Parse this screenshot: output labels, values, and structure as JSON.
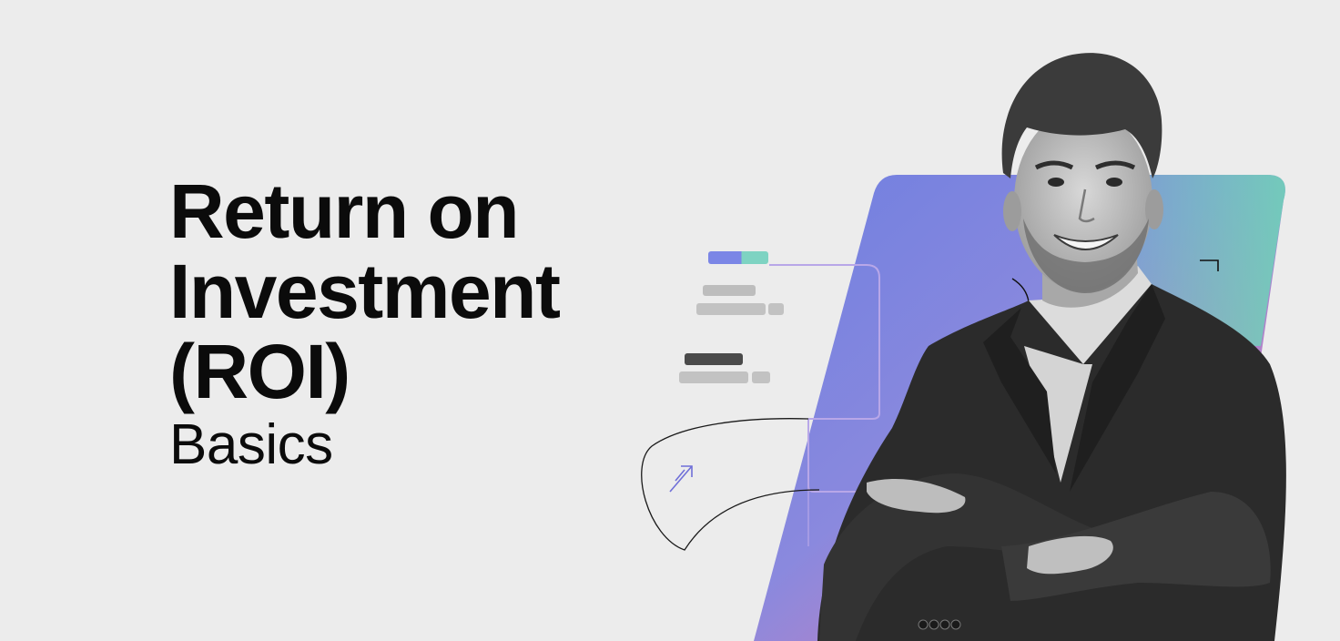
{
  "hero": {
    "title_lines": [
      "Return on",
      "Investment",
      "(ROI)"
    ],
    "subtitle": "Basics"
  },
  "colors": {
    "background": "#ececec",
    "text": "#0b0b0b",
    "gradient_blue": "#6f7fe0",
    "gradient_teal": "#6fd1b8",
    "gradient_pink": "#f07aa8",
    "bar_accent_blue": "#7b86e6",
    "bar_accent_teal": "#7ed3c2",
    "bar_dark": "#4a4a4a",
    "bar_gray": "#bdbdbd",
    "line_purple": "#b8a7e8"
  },
  "illustration": {
    "person": "smiling man in dark suit with crossed arms, grayscale photo",
    "icons": [
      "arrow-up-right-icon",
      "corner-bracket-icon"
    ]
  }
}
